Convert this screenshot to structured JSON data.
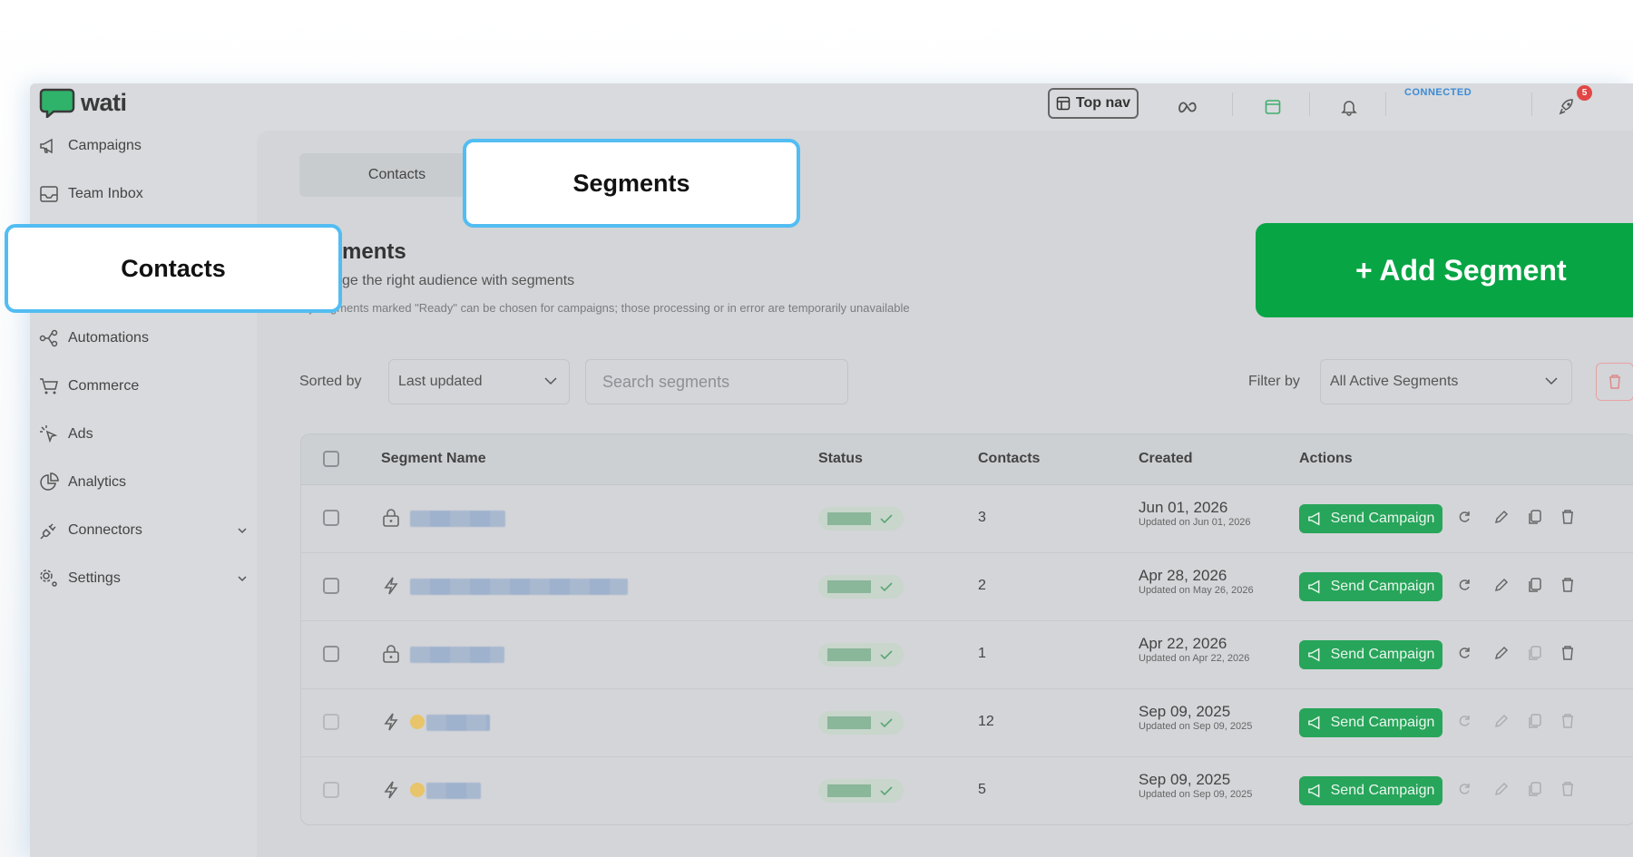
{
  "brand": {
    "logo_text": "wati",
    "accent": "#27a55a",
    "highlight": "#52bdf2"
  },
  "topbar": {
    "topnav_label": "Top nav",
    "connection_status": "CONNECTED",
    "notification_count": "5",
    "icons": [
      "layout-icon",
      "meta-icon",
      "browser-icon",
      "bell-icon",
      "rocket-icon"
    ]
  },
  "sidebar": {
    "items": [
      {
        "label": "Campaigns",
        "icon": "megaphone-icon"
      },
      {
        "label": "Team Inbox",
        "icon": "inbox-icon"
      },
      {
        "label": "Automations",
        "icon": "flow-icon"
      },
      {
        "label": "Commerce",
        "icon": "cart-icon"
      },
      {
        "label": "Ads",
        "icon": "cursor-icon"
      },
      {
        "label": "Analytics",
        "icon": "pie-icon"
      },
      {
        "label": "Connectors",
        "icon": "plug-icon"
      },
      {
        "label": "Settings",
        "icon": "gear-icon"
      }
    ]
  },
  "tabs": {
    "contacts": "Contacts",
    "segments": "Segments"
  },
  "page": {
    "title": "ments",
    "subtitle": "ge the right audience with segments",
    "note": "nly segments marked \"Ready\" can be chosen for campaigns; those processing or in error are temporarily unavailable"
  },
  "controls": {
    "sorted_by_label": "Sorted by",
    "sort_value": "Last updated",
    "search_placeholder": "Search segments",
    "filter_by_label": "Filter by",
    "filter_value": "All Active Segments"
  },
  "table": {
    "headers": {
      "name": "Segment Name",
      "status": "Status",
      "contacts": "Contacts",
      "created": "Created",
      "actions": "Actions"
    },
    "send_label": "Send Campaign",
    "rows": [
      {
        "contacts": "3",
        "created": "Jun 01, 2026",
        "updated": "Updated on Jun 01, 2026",
        "type": "lock-icon"
      },
      {
        "contacts": "2",
        "created": "Apr 28, 2026",
        "updated": "Updated on May 26, 2026",
        "type": "bolt-icon"
      },
      {
        "contacts": "1",
        "created": "Apr 22, 2026",
        "updated": "Updated on Apr 22, 2026",
        "type": "lock-icon"
      },
      {
        "contacts": "12",
        "created": "Sep 09, 2025",
        "updated": "Updated on Sep 09, 2025",
        "type": "bolt-icon"
      },
      {
        "contacts": "5",
        "created": "Sep 09, 2025",
        "updated": "Updated on Sep 09, 2025",
        "type": "bolt-icon"
      }
    ]
  },
  "callouts": {
    "segments": "Segments",
    "contacts": "Contacts",
    "add_segment": "+ Add Segment"
  }
}
